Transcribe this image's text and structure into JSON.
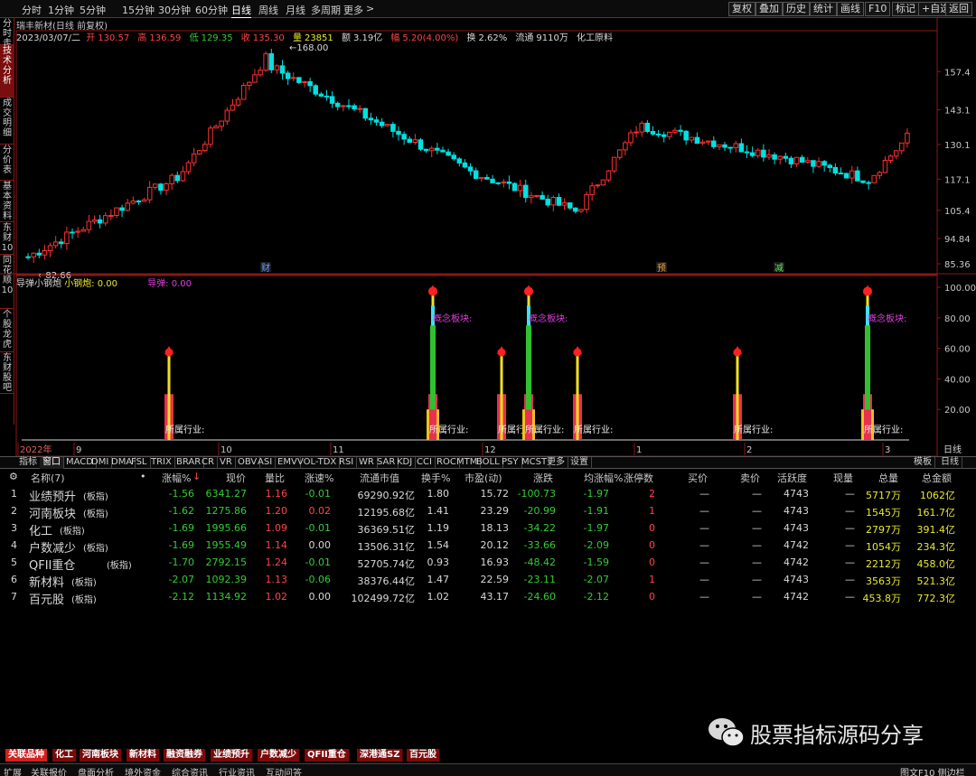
{
  "topbar": {
    "periods": [
      "分时",
      "1分钟",
      "5分钟",
      "15分钟",
      "30分钟",
      "60分钟",
      "日线",
      "周线",
      "月线",
      "多周期",
      "更多"
    ],
    "active_period": "日线",
    "right_buttons": [
      "复权",
      "叠加",
      "历史",
      "统计",
      "画线",
      "F10",
      "标记",
      "+自选",
      "返回"
    ]
  },
  "sidebar": [
    "分时走势",
    "技术分析",
    "成交明细",
    "分价表",
    "基本资料",
    "东财10",
    "同花顺10",
    "个股龙虎",
    "东财股吧"
  ],
  "chart_header": {
    "title": "瑞丰新材(日线 前复权)"
  },
  "ohlc": {
    "date": "2023/03/07/二",
    "open_label": "开",
    "open": "130.57",
    "high_label": "高",
    "high": "136.59",
    "low_label": "低",
    "low": "129.35",
    "close_label": "收",
    "close": "135.30",
    "vol_label": "量",
    "vol": "23851",
    "amt_label": "额",
    "amt": "3.19亿",
    "chg_label": "幅",
    "chg": "5.20(4.00%)",
    "turn_label": "换",
    "turn": "2.62%",
    "float_label": "流通",
    "float": "9110万",
    "industry": "化工原料"
  },
  "chart_data": [
    {
      "type": "candlestick",
      "title": "瑞丰新材(日线 前复权)",
      "y_ticks": [
        157.4,
        143.1,
        130.1,
        117.1,
        105.4,
        94.84,
        85.36
      ],
      "annotations": {
        "high": "168.00",
        "low": "82.66"
      },
      "event_markers": [
        "财",
        "预",
        "减"
      ],
      "month_labels": [
        "2022年",
        "9",
        "10",
        "11",
        "12",
        "1",
        "2",
        "3"
      ],
      "ylim": [
        82.66,
        168.0
      ]
    },
    {
      "type": "bar",
      "title": "导弹小钢炮",
      "y_ticks": [
        100.0,
        80.0,
        60.0,
        40.0,
        20.0
      ],
      "ylim": [
        0,
        100
      ],
      "labels": [
        "所属行业:",
        "概念板块:"
      ]
    }
  ],
  "indicator": {
    "name": "导弹小钢炮",
    "value_label": "小钢炮: 0.00",
    "missile_label": "导弹: 0.00",
    "industry_text": "所属行业:",
    "concept_text": "概念板块:"
  },
  "tabs": [
    "指标",
    "窗口",
    "MACD",
    "DMI",
    "DMA",
    "FSL",
    "TRIX",
    "BRAR",
    "CR",
    "VR",
    "OBV",
    "ASI",
    "EMV",
    "VOL-TDX",
    "RSI",
    "WR",
    "SAR",
    "KDJ",
    "CCI",
    "ROC",
    "MTM",
    "BOLL",
    "PSY",
    "MCST",
    "更多",
    "设置"
  ],
  "tabs_right": [
    "模板",
    "日线"
  ],
  "table": {
    "headers": [
      "名称(7)",
      "涨幅%",
      "现价",
      "量比",
      "涨速%",
      "流通市值",
      "换手%",
      "市盈(动)",
      "涨跌",
      "均涨幅%",
      "涨停数",
      "买价",
      "卖价",
      "活跃度",
      "现量",
      "总量",
      "总金额"
    ],
    "rows": [
      {
        "no": "1",
        "name": "业绩预升",
        "tag": "(板指)",
        "chg": "-1.56",
        "price": "6341.27",
        "lb": "1.16",
        "speed": "-0.01",
        "cap": "69290.92亿",
        "turn": "1.80",
        "pe": "15.72",
        "diff": "-100.73",
        "avg": "-1.97",
        "limit": "2",
        "buy": "—",
        "sell": "—",
        "act": "4743",
        "cur": "—",
        "vol": "5717万",
        "amt": "1062亿"
      },
      {
        "no": "2",
        "name": "河南板块",
        "tag": "(板指)",
        "chg": "-1.62",
        "price": "1275.86",
        "lb": "1.20",
        "speed": "0.02",
        "cap": "12195.68亿",
        "turn": "1.41",
        "pe": "23.29",
        "diff": "-20.99",
        "avg": "-1.91",
        "limit": "1",
        "buy": "—",
        "sell": "—",
        "act": "4743",
        "cur": "—",
        "vol": "1545万",
        "amt": "161.7亿"
      },
      {
        "no": "3",
        "name": "化工",
        "tag": "(板指)",
        "chg": "-1.69",
        "price": "1995.66",
        "lb": "1.09",
        "speed": "-0.01",
        "cap": "36369.51亿",
        "turn": "1.19",
        "pe": "18.13",
        "diff": "-34.22",
        "avg": "-1.97",
        "limit": "0",
        "buy": "—",
        "sell": "—",
        "act": "4743",
        "cur": "—",
        "vol": "2797万",
        "amt": "391.4亿"
      },
      {
        "no": "4",
        "name": "户数减少",
        "tag": "(板指)",
        "chg": "-1.69",
        "price": "1955.49",
        "lb": "1.14",
        "speed": "0.00",
        "cap": "13506.31亿",
        "turn": "1.54",
        "pe": "20.12",
        "diff": "-33.66",
        "avg": "-2.09",
        "limit": "0",
        "buy": "—",
        "sell": "—",
        "act": "4742",
        "cur": "—",
        "vol": "1054万",
        "amt": "234.3亿"
      },
      {
        "no": "5",
        "name": "QFII重仓",
        "tag": "(板指)",
        "chg": "-1.70",
        "price": "2792.15",
        "lb": "1.24",
        "speed": "-0.01",
        "cap": "52705.74亿",
        "turn": "0.93",
        "pe": "16.93",
        "diff": "-48.42",
        "avg": "-1.59",
        "limit": "0",
        "buy": "—",
        "sell": "—",
        "act": "4742",
        "cur": "—",
        "vol": "2212万",
        "amt": "458.0亿"
      },
      {
        "no": "6",
        "name": "新材料",
        "tag": "(板指)",
        "chg": "-2.07",
        "price": "1092.39",
        "lb": "1.13",
        "speed": "-0.06",
        "cap": "38376.44亿",
        "turn": "1.47",
        "pe": "22.59",
        "diff": "-23.11",
        "avg": "-2.07",
        "limit": "1",
        "buy": "—",
        "sell": "—",
        "act": "4743",
        "cur": "—",
        "vol": "3563万",
        "amt": "521.3亿"
      },
      {
        "no": "7",
        "name": "百元股",
        "tag": "(板指)",
        "chg": "-2.12",
        "price": "1134.92",
        "lb": "1.02",
        "speed": "0.00",
        "cap": "102499.72亿",
        "turn": "1.02",
        "pe": "43.17",
        "diff": "-24.60",
        "avg": "-2.12",
        "limit": "0",
        "buy": "—",
        "sell": "—",
        "act": "4742",
        "cur": "—",
        "vol": "453.8万",
        "amt": "772.3亿"
      }
    ]
  },
  "bottom_tabs": [
    "关联品种",
    "化工",
    "河南板块",
    "新材料",
    "融资融券",
    "业绩预升",
    "户数减少",
    "QFII重仓",
    "深港通SZ",
    "百元股"
  ],
  "status": {
    "items": [
      "扩展",
      "关联报价",
      "盘面分析",
      "境外资金",
      "综合资讯",
      "行业资讯",
      "互动问答"
    ],
    "right": "图文F10 侧边栏"
  },
  "watermark": "股票指标源码分享",
  "colors": {
    "up": "#ff3030",
    "down": "#00e0e0",
    "bg": "#000000",
    "grid": "#8a1818"
  }
}
